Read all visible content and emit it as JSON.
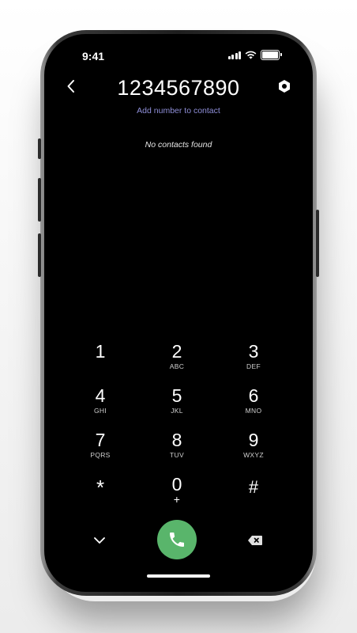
{
  "status_bar": {
    "time": "9:41"
  },
  "dialer": {
    "number": "1234567890",
    "add_contact_label": "Add number to contact",
    "no_contacts_label": "No contacts found"
  },
  "keypad": {
    "keys": [
      {
        "digit": "1",
        "letters": ""
      },
      {
        "digit": "2",
        "letters": "ABC"
      },
      {
        "digit": "3",
        "letters": "DEF"
      },
      {
        "digit": "4",
        "letters": "GHI"
      },
      {
        "digit": "5",
        "letters": "JKL"
      },
      {
        "digit": "6",
        "letters": "MNO"
      },
      {
        "digit": "7",
        "letters": "PQRS"
      },
      {
        "digit": "8",
        "letters": "TUV"
      },
      {
        "digit": "9",
        "letters": "WXYZ"
      },
      {
        "digit": "*",
        "letters": ""
      },
      {
        "digit": "0",
        "letters": "+"
      },
      {
        "digit": "#",
        "letters": ""
      }
    ]
  },
  "icons": {
    "back": "chevron-left-icon",
    "settings": "hexagon-settings-icon",
    "collapse": "chevron-down-icon",
    "call": "phone-icon",
    "backspace": "backspace-icon"
  },
  "colors": {
    "accent_link": "#8f8fd8",
    "call_button": "#59b56b",
    "screen_background": "#000000"
  }
}
